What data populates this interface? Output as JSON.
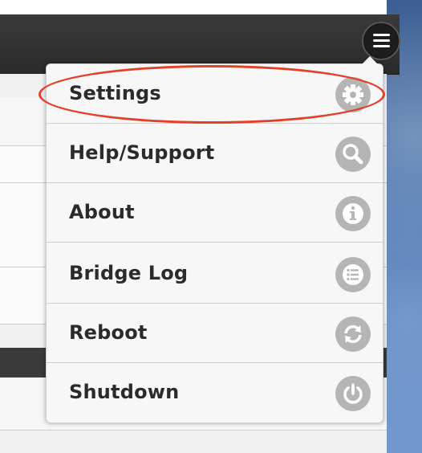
{
  "menu": {
    "toggle_icon": "hamburger-icon",
    "items": [
      {
        "label": "Settings",
        "icon": "gear-icon"
      },
      {
        "label": "Help/Support",
        "icon": "search-icon"
      },
      {
        "label": "About",
        "icon": "info-icon"
      },
      {
        "label": "Bridge Log",
        "icon": "list-icon"
      },
      {
        "label": "Reboot",
        "icon": "refresh-icon"
      },
      {
        "label": "Shutdown",
        "icon": "power-icon"
      }
    ]
  },
  "colors": {
    "header": "#2f2f2f",
    "menu_bg": "#f7f7f7",
    "icon_circle": "#b5b5b5",
    "annotation": "#e0412a"
  },
  "annotation": {
    "highlighted_item": "Settings",
    "shape": "ellipse"
  }
}
